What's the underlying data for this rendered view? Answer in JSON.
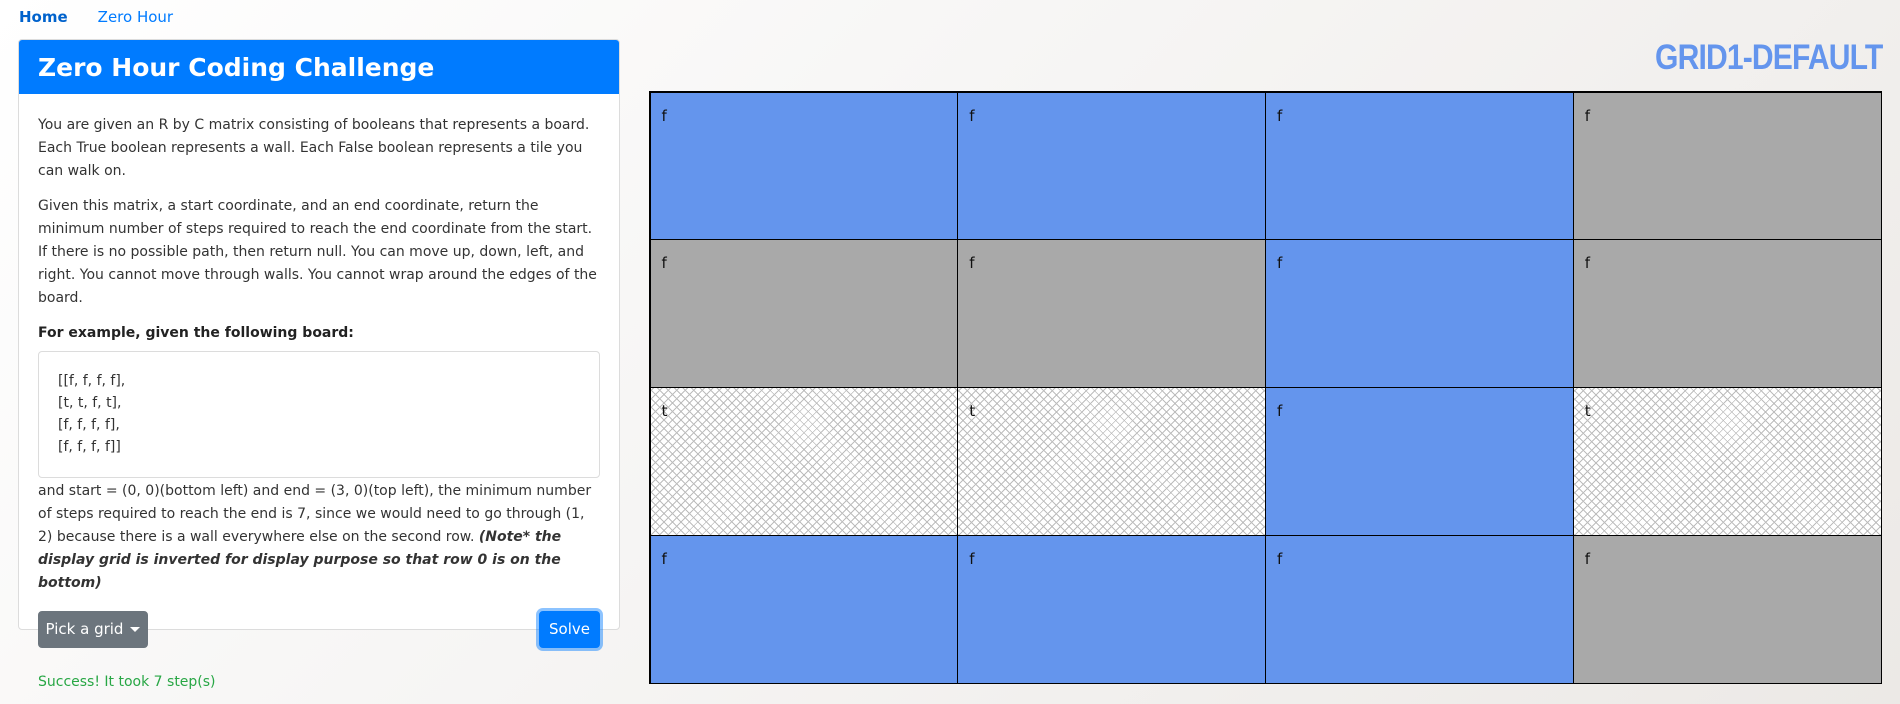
{
  "nav": {
    "home": "Home",
    "zero_hour": "Zero Hour"
  },
  "card": {
    "title": "Zero Hour Coding Challenge",
    "p1": "You are given an R by C matrix consisting of booleans that represents a board. Each True boolean represents a wall. Each False boolean represents a tile you can walk on.",
    "p2": "Given this matrix, a start coordinate, and an end coordinate, return the minimum number of steps required to reach the end coordinate from the start. If there is no possible path, then return null. You can move up, down, left, and right. You cannot move through walls. You cannot wrap around the edges of the board.",
    "example_label": "For example, given the following board:",
    "board_lines": [
      "[[f, f, f, f],",
      "[t, t, f, t],",
      "[f, f, f, f],",
      "[f, f, f, f]]"
    ],
    "p3_text": "and start = (0, 0)(bottom left) and end = (3, 0)(top left), the minimum number of steps required to reach the end is 7, since we would need to go through (1, 2) because there is a wall everywhere else on the second row. ",
    "p3_note": "(Note* the display grid is inverted for display purpose so that row 0 is on the bottom)",
    "pick_button": "Pick a grid",
    "solve_button": "Solve",
    "status": "Success! It took 7 step(s)"
  },
  "grid": {
    "title": "GRID1-DEFAULT",
    "colors": {
      "path": "#6495ed",
      "floor": "#a9a9a9",
      "wall": "#ffffff"
    },
    "rows": [
      [
        {
          "label": "f",
          "type": "path"
        },
        {
          "label": "f",
          "type": "path"
        },
        {
          "label": "f",
          "type": "path"
        },
        {
          "label": "f",
          "type": "floor"
        }
      ],
      [
        {
          "label": "f",
          "type": "floor"
        },
        {
          "label": "f",
          "type": "floor"
        },
        {
          "label": "f",
          "type": "path"
        },
        {
          "label": "f",
          "type": "floor"
        }
      ],
      [
        {
          "label": "t",
          "type": "wall"
        },
        {
          "label": "t",
          "type": "wall"
        },
        {
          "label": "f",
          "type": "path"
        },
        {
          "label": "t",
          "type": "wall"
        }
      ],
      [
        {
          "label": "f",
          "type": "path"
        },
        {
          "label": "f",
          "type": "path"
        },
        {
          "label": "f",
          "type": "path"
        },
        {
          "label": "f",
          "type": "floor"
        }
      ]
    ]
  }
}
